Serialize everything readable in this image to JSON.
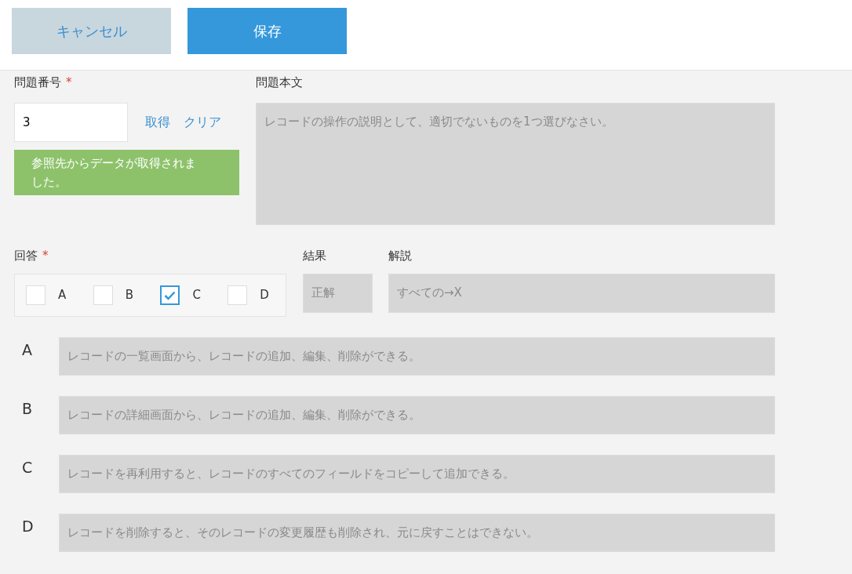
{
  "buttons": [
    {
      "label": "キャンセル",
      "kind": "cancel"
    },
    {
      "label": "保存",
      "kind": "save"
    }
  ],
  "question_number": {
    "label": "問題番号",
    "required_mark": "*",
    "value": "3",
    "links": [
      "取得",
      "クリア"
    ],
    "message": "参照先からデータが取得されました。"
  },
  "question_text": {
    "label": "問題本文",
    "value": "レコードの操作の説明として、適切でないものを1つ選びなさい。"
  },
  "answer": {
    "label": "回答",
    "required_mark": "*",
    "options": [
      {
        "label": "A",
        "checked": false
      },
      {
        "label": "B",
        "checked": false
      },
      {
        "label": "C",
        "checked": true
      },
      {
        "label": "D",
        "checked": false
      }
    ]
  },
  "result": {
    "label": "結果",
    "value": "正解"
  },
  "explanation": {
    "label": "解説",
    "value": "すべての→X"
  },
  "choices": [
    {
      "letter": "A",
      "text": "レコードの一覧画面から、レコードの追加、編集、削除ができる。"
    },
    {
      "letter": "B",
      "text": "レコードの詳細画面から、レコードの追加、編集、削除ができる。"
    },
    {
      "letter": "C",
      "text": "レコードを再利用すると、レコードのすべてのフィールドをコピーして追加できる。"
    },
    {
      "letter": "D",
      "text": "レコードを削除すると、そのレコードの変更履歴も削除され、元に戻すことはできない。"
    }
  ]
}
